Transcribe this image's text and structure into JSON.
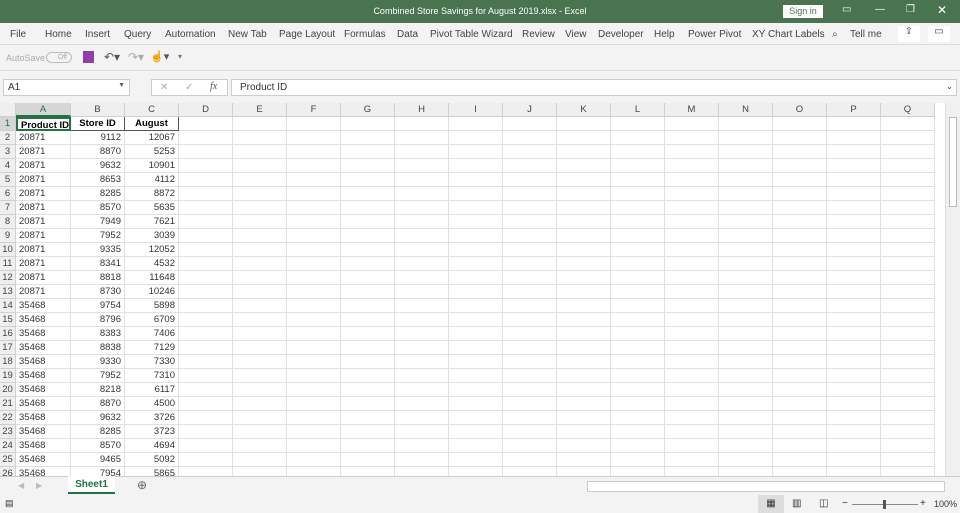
{
  "window": {
    "title": "Combined Store Savings for August 2019.xlsx  -  Excel",
    "sign_in": "Sign in"
  },
  "ribbon_tabs": [
    "File",
    "Home",
    "Insert",
    "Query",
    "Automation",
    "New Tab",
    "Page Layout",
    "Formulas",
    "Data",
    "Pivot Table Wizard",
    "Review",
    "View",
    "Developer",
    "Help",
    "Power Pivot",
    "XY Chart Labels"
  ],
  "tell_me": "Tell me",
  "qat": {
    "autosave": "AutoSave",
    "autosave_state": "Off"
  },
  "formula_bar": {
    "name_box": "A1",
    "fx": "fx",
    "formula": "Product ID"
  },
  "columns": [
    "A",
    "B",
    "C",
    "D",
    "E",
    "F",
    "G",
    "H",
    "I",
    "J",
    "K",
    "L",
    "M",
    "N",
    "O",
    "P",
    "Q"
  ],
  "rows": [
    [
      "Product ID",
      "Store ID",
      "August"
    ],
    [
      "20871",
      "9112",
      "12067"
    ],
    [
      "20871",
      "8870",
      "5253"
    ],
    [
      "20871",
      "9632",
      "10901"
    ],
    [
      "20871",
      "8653",
      "4112"
    ],
    [
      "20871",
      "8285",
      "8872"
    ],
    [
      "20871",
      "8570",
      "5635"
    ],
    [
      "20871",
      "7949",
      "7621"
    ],
    [
      "20871",
      "7952",
      "3039"
    ],
    [
      "20871",
      "9335",
      "12052"
    ],
    [
      "20871",
      "8341",
      "4532"
    ],
    [
      "20871",
      "8818",
      "11648"
    ],
    [
      "20871",
      "8730",
      "10246"
    ],
    [
      "35468",
      "9754",
      "5898"
    ],
    [
      "35468",
      "8796",
      "6709"
    ],
    [
      "35468",
      "8383",
      "7406"
    ],
    [
      "35468",
      "8838",
      "7129"
    ],
    [
      "35468",
      "9330",
      "7330"
    ],
    [
      "35468",
      "7952",
      "7310"
    ],
    [
      "35468",
      "8218",
      "6117"
    ],
    [
      "35468",
      "8870",
      "4500"
    ],
    [
      "35468",
      "9632",
      "3726"
    ],
    [
      "35468",
      "8285",
      "3723"
    ],
    [
      "35468",
      "8570",
      "4694"
    ],
    [
      "35468",
      "9465",
      "5092"
    ],
    [
      "35468",
      "7954",
      "5865"
    ]
  ],
  "sheets": [
    "Sheet1"
  ],
  "status": {
    "zoom": "100%"
  }
}
